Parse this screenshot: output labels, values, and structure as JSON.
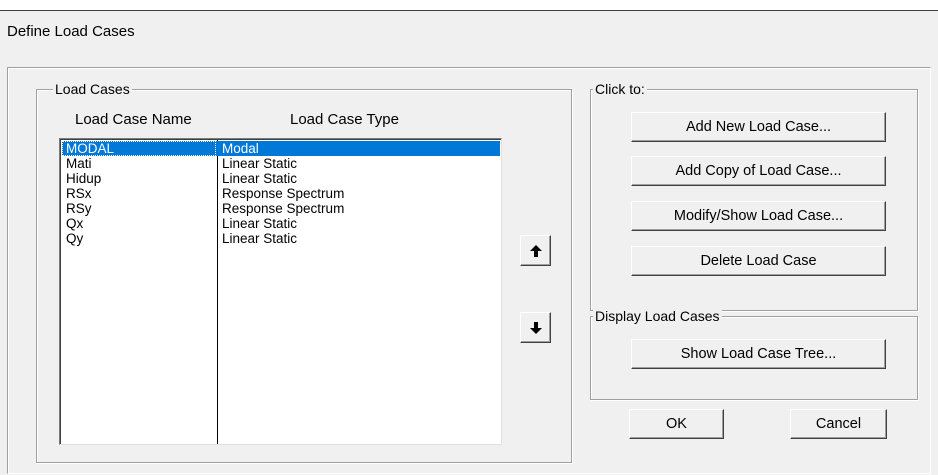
{
  "dialog": {
    "title": "Define Load Cases"
  },
  "load_cases_group": {
    "title": "Load Cases",
    "col_name_header": "Load Case Name",
    "col_type_header": "Load Case Type",
    "rows": [
      {
        "name": "MODAL",
        "type": "Modal",
        "selected": true
      },
      {
        "name": "Mati",
        "type": "Linear Static",
        "selected": false
      },
      {
        "name": "Hidup",
        "type": "Linear Static",
        "selected": false
      },
      {
        "name": "RSx",
        "type": "Response Spectrum",
        "selected": false
      },
      {
        "name": "RSy",
        "type": "Response Spectrum",
        "selected": false
      },
      {
        "name": "Qx",
        "type": "Linear Static",
        "selected": false
      },
      {
        "name": "Qy",
        "type": "Linear Static",
        "selected": false
      }
    ],
    "move_up_icon": "arrow-up-icon",
    "move_down_icon": "arrow-down-icon"
  },
  "click_to_group": {
    "title": "Click to:",
    "add_new_label": "Add New Load Case...",
    "add_copy_label": "Add Copy of Load Case...",
    "modify_show_label": "Modify/Show Load Case...",
    "delete_label": "Delete Load Case"
  },
  "display_group": {
    "title": "Display Load Cases",
    "show_tree_label": "Show Load Case Tree..."
  },
  "footer": {
    "ok_label": "OK",
    "cancel_label": "Cancel"
  },
  "colors": {
    "selection": "#0078d7",
    "dialog_bg": "#f0f0f0"
  }
}
